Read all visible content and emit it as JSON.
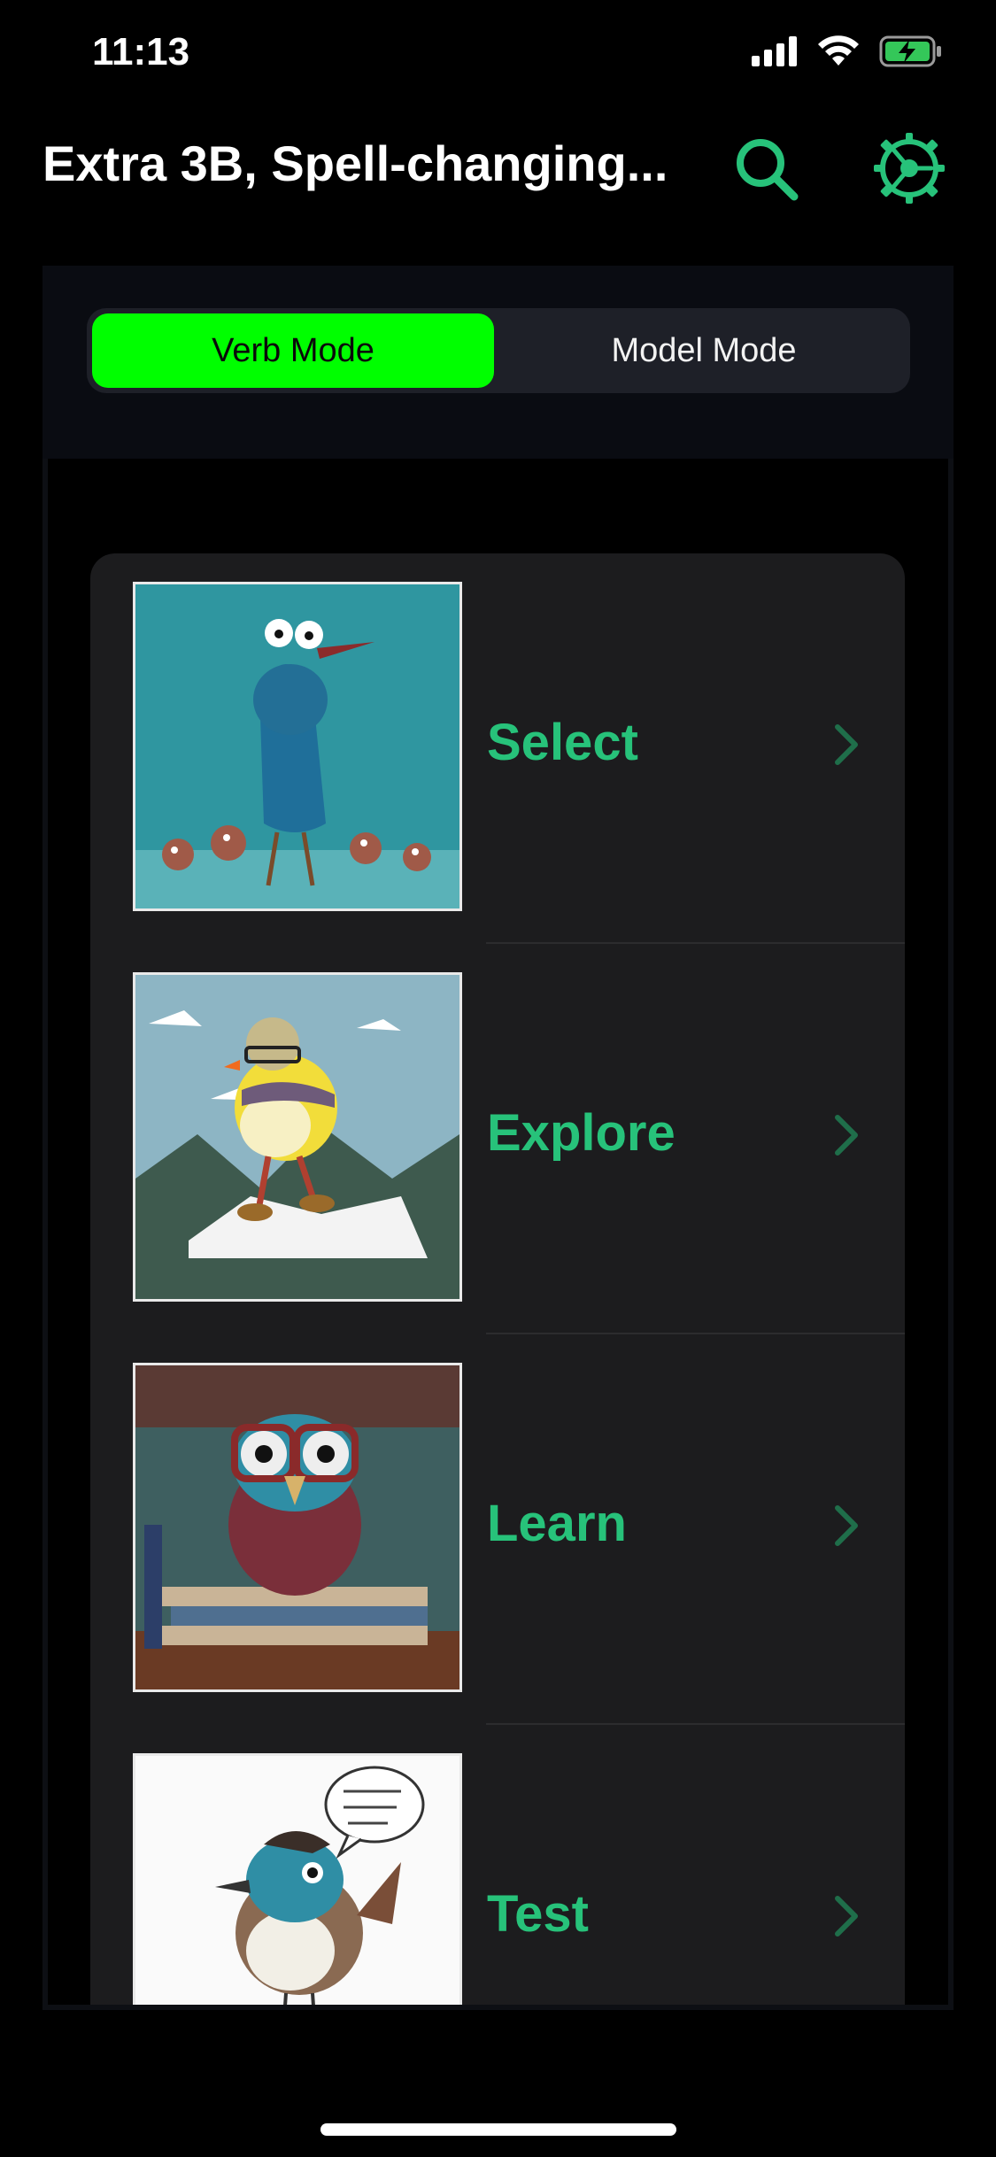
{
  "status_bar": {
    "time": "11:13",
    "icons": [
      "cellular-icon",
      "wifi-icon",
      "battery-charging-icon"
    ]
  },
  "nav": {
    "title": "Extra 3B, Spell-changing...",
    "search_icon": "search-icon",
    "settings_icon": "gear-icon"
  },
  "mode_selector": {
    "options": [
      "Verb Mode",
      "Model Mode"
    ],
    "selected": "Verb Mode"
  },
  "menu": {
    "items": [
      {
        "label": "Select",
        "image": "bird-family-illustration"
      },
      {
        "label": "Explore",
        "image": "bird-hiker-mountain-illustration"
      },
      {
        "label": "Learn",
        "image": "bird-glasses-books-illustration"
      },
      {
        "label": "Test",
        "image": "bird-sketch-speech-bubble-illustration"
      }
    ]
  },
  "colors": {
    "accent": "#27c27a",
    "active_segment": "#00ff00",
    "background": "#000000",
    "card": "#1c1c1e"
  }
}
